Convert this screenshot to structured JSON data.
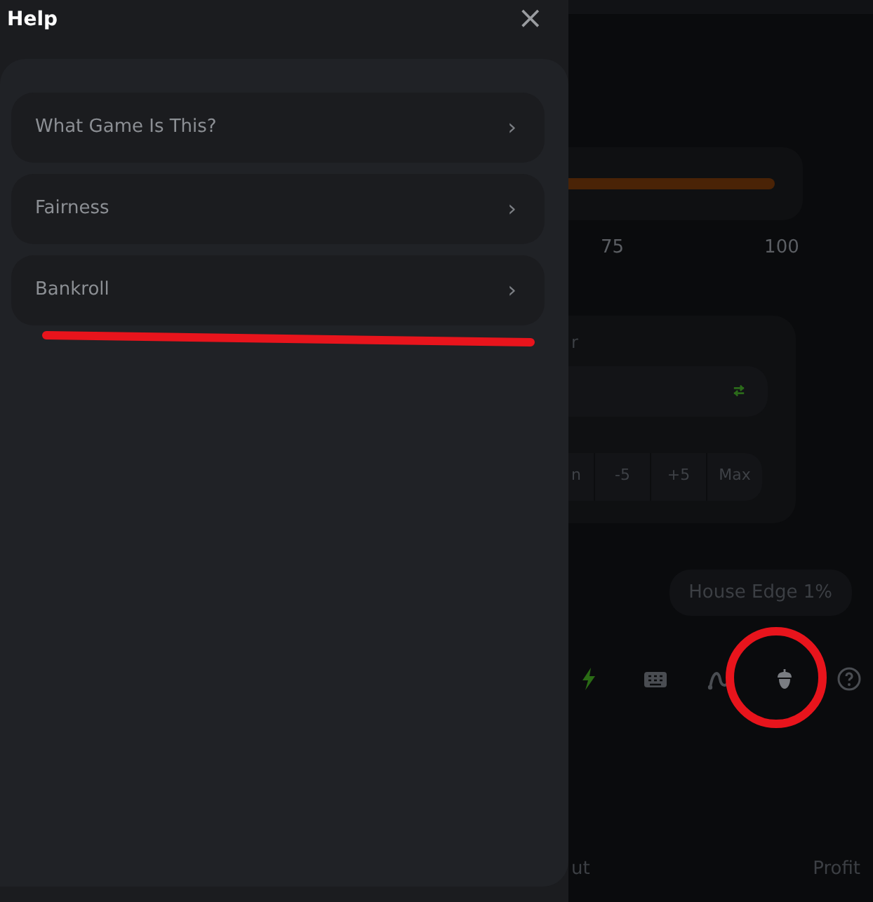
{
  "help_panel": {
    "title": "Help",
    "close": "×",
    "items": [
      {
        "label": "What Game Is This?",
        "chevron": "›"
      },
      {
        "label": "Fairness",
        "chevron": "›"
      },
      {
        "label": "Bankroll",
        "chevron": "›"
      }
    ]
  },
  "game": {
    "scale_labels": [
      "75",
      "100"
    ],
    "bet_card": {
      "label": "r",
      "buttons": [
        "n",
        "-5",
        "+5",
        "Max"
      ]
    },
    "house_edge": "House Edge 1%",
    "toolbar": [
      {
        "kind": "bolt"
      },
      {
        "kind": "keyboard"
      },
      {
        "kind": "curve"
      },
      {
        "kind": "acorn"
      },
      {
        "kind": "help"
      }
    ],
    "footer": [
      "ut",
      "Profit"
    ]
  }
}
